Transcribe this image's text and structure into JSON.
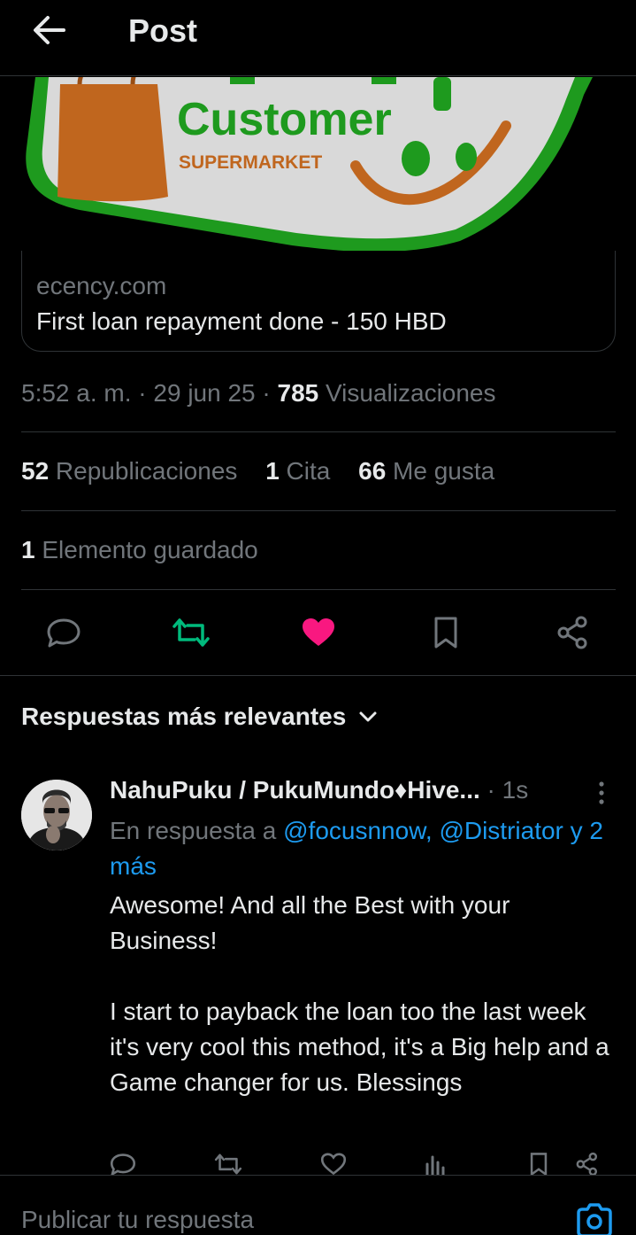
{
  "header": {
    "title": "Post",
    "back_icon": "arrow-left-icon"
  },
  "media": {
    "logo_word": "Customer",
    "logo_sub": "SUPERMARKET"
  },
  "link_card": {
    "domain": "ecency.com",
    "title": "First loan repayment done - 150 HBD"
  },
  "meta": {
    "time": "5:52 a. m.",
    "sep1": " · ",
    "date": "29 jun 25",
    "sep2": " · ",
    "views_count": "785",
    "views_label": " Visualizaciones"
  },
  "stats": {
    "reposts_count": "52",
    "reposts_label": " Republicaciones",
    "quotes_count": "1",
    "quotes_label": " Cita",
    "likes_count": "66",
    "likes_label": " Me gusta",
    "bookmarks_count": "1",
    "bookmarks_label": " Elemento guardado"
  },
  "actions": [
    "reply-icon",
    "repost-icon",
    "like-icon",
    "bookmark-icon",
    "share-icon"
  ],
  "colors": {
    "background": "#000000",
    "text": "#e7e9ea",
    "muted": "#71767b",
    "accent": "#1d9bf0",
    "repost_green": "#00ba7c",
    "like_pink": "#f91880",
    "divider": "#2f3336"
  },
  "replies_sort": {
    "label": "Respuestas más relevantes"
  },
  "reply": {
    "author": "NahuPuku / PukuMundo♦Hive...",
    "time": " · 1s",
    "reply_to_prefix": "En respuesta a ",
    "mention_1": "@focusnnow,",
    "mention_2": "@Distriator",
    "mention_more": "y 2 más",
    "text": "Awesome! And all the Best with your Business!\n\nI start to payback the loan too the last week it's very cool this method, it's a Big help and a Game changer for us. Blessings"
  },
  "composer": {
    "placeholder": "Publicar tu respuesta"
  }
}
